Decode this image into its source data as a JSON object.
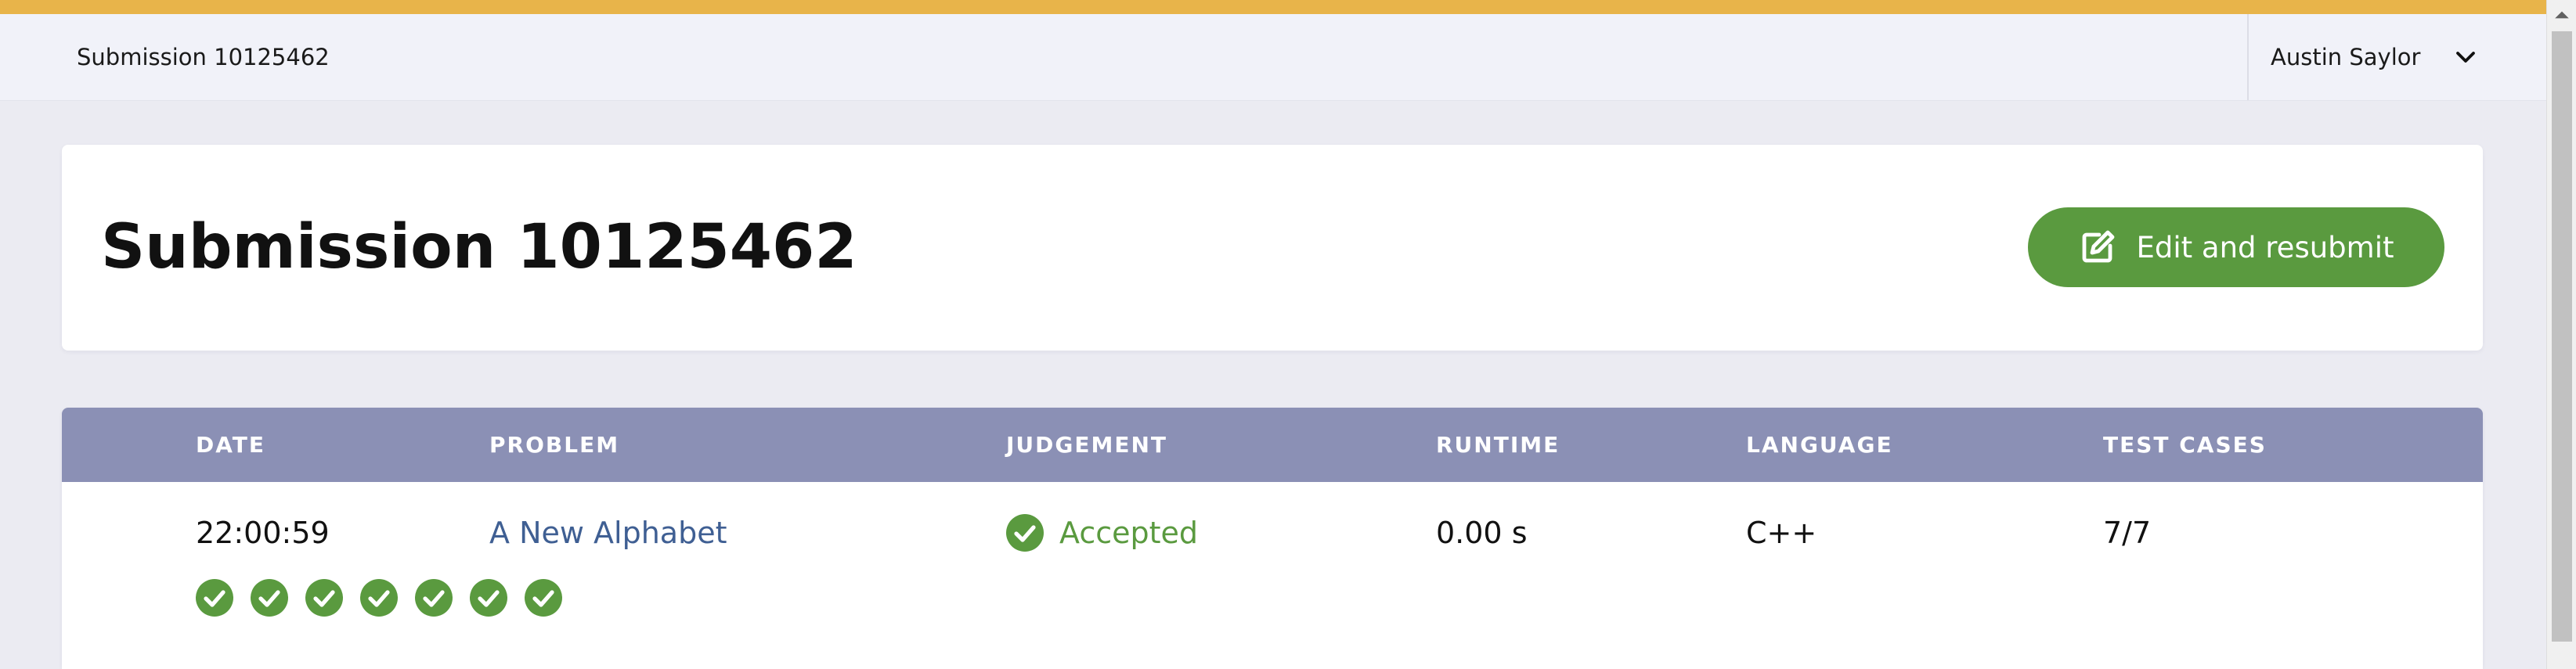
{
  "colors": {
    "accent_bar": "#e8b44a",
    "success": "#5a9a3f",
    "table_header": "#8b90b5",
    "link": "#3f5f93"
  },
  "topbar": {
    "breadcrumb": "Submission 10125462",
    "user": {
      "name": "Austin Saylor",
      "menu_icon": "chevron-down-icon"
    }
  },
  "header": {
    "title": "Submission 10125462",
    "resubmit_button": {
      "label": "Edit and resubmit",
      "icon": "edit-icon"
    }
  },
  "table": {
    "columns": [
      "DATE",
      "PROBLEM",
      "JUDGEMENT",
      "RUNTIME",
      "LANGUAGE",
      "TEST CASES"
    ],
    "row": {
      "date": "22:00:59",
      "problem": "A New Alphabet",
      "judgement": "Accepted",
      "runtime": "0.00 s",
      "language": "C++",
      "test_cases": "7/7"
    },
    "test_case_results": [
      "passed",
      "passed",
      "passed",
      "passed",
      "passed",
      "passed",
      "passed"
    ]
  }
}
